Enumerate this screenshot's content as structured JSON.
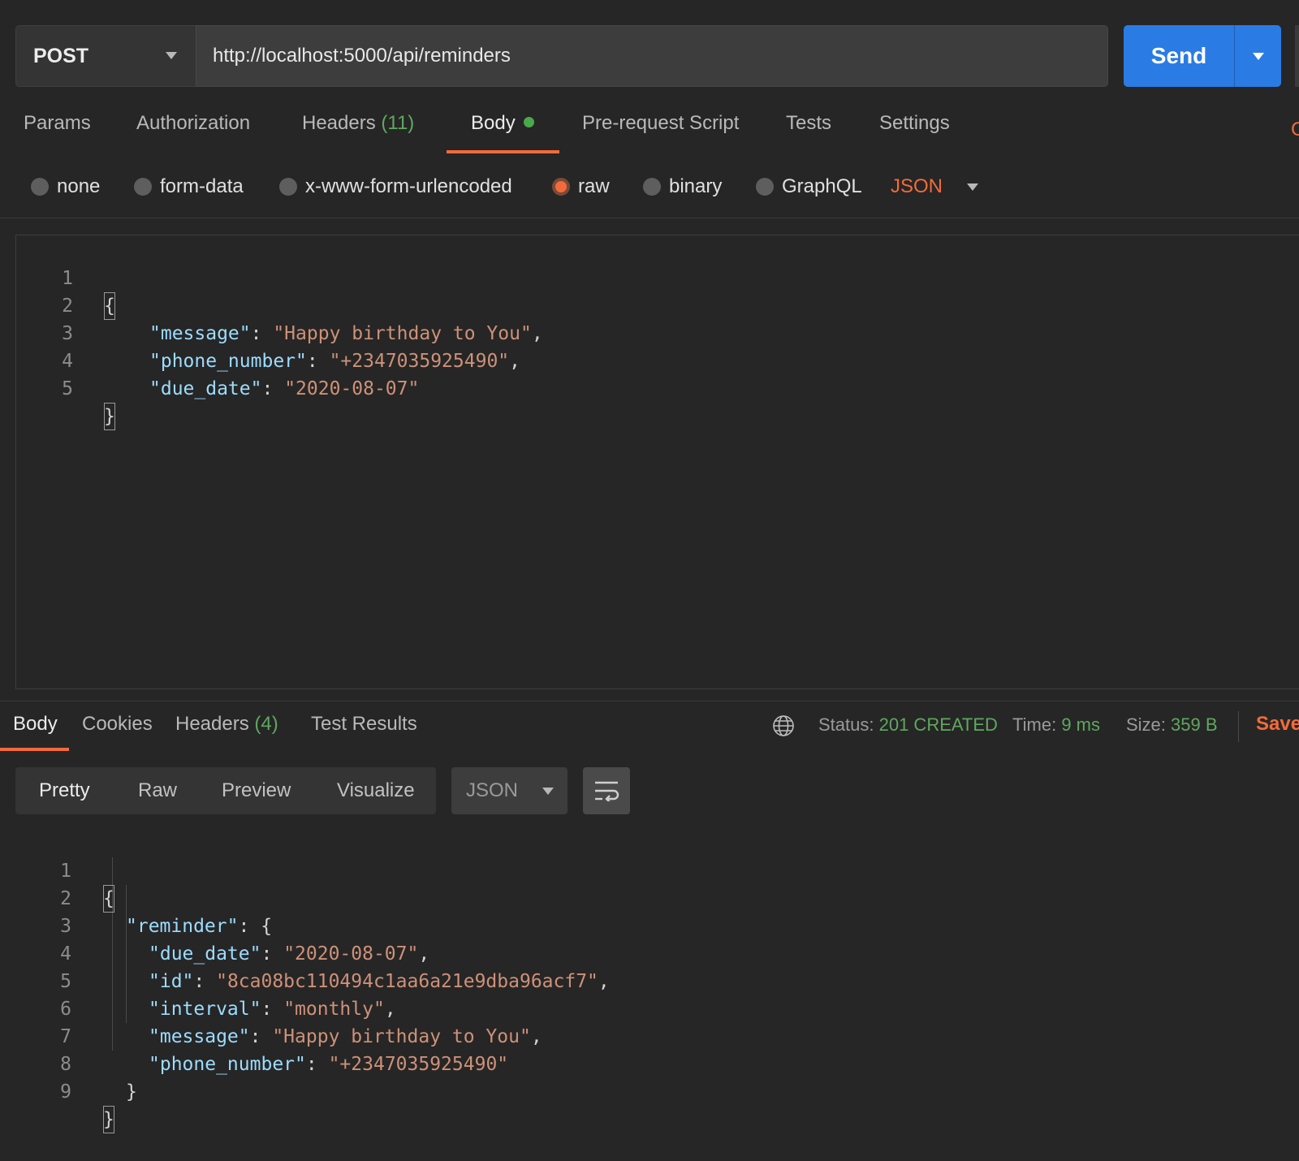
{
  "request": {
    "method": "POST",
    "url": "http://localhost:5000/api/reminders",
    "send_label": "Send"
  },
  "request_tabs": [
    {
      "label": "Params"
    },
    {
      "label": "Authorization"
    },
    {
      "label": "Headers",
      "count": "(11)"
    },
    {
      "label": "Body",
      "active": true
    },
    {
      "label": "Pre-request Script"
    },
    {
      "label": "Tests"
    },
    {
      "label": "Settings"
    }
  ],
  "cookies_edge": "C",
  "body_types": [
    {
      "label": "none"
    },
    {
      "label": "form-data"
    },
    {
      "label": "x-www-form-urlencoded"
    },
    {
      "label": "raw",
      "selected": true
    },
    {
      "label": "binary"
    },
    {
      "label": "GraphQL"
    }
  ],
  "body_language": "JSON",
  "request_body_lines": [
    {
      "n": "1",
      "text": "{"
    },
    {
      "n": "2",
      "key": "\"message\"",
      "value": "\"Happy birthday to You\"",
      "trail": ","
    },
    {
      "n": "3",
      "key": "\"phone_number\"",
      "value": "\"+2347035925490\"",
      "trail": ","
    },
    {
      "n": "4",
      "key": "\"due_date\"",
      "value": "\"2020-08-07\"",
      "trail": ""
    },
    {
      "n": "5",
      "text": "}"
    }
  ],
  "response_tabs": [
    {
      "label": "Body",
      "active": true
    },
    {
      "label": "Cookies"
    },
    {
      "label": "Headers",
      "count": "(4)"
    },
    {
      "label": "Test Results"
    }
  ],
  "response_status": {
    "status_label": "Status:",
    "status_value": "201 CREATED",
    "time_label": "Time:",
    "time_value": "9 ms",
    "size_label": "Size:",
    "size_value": "359 B",
    "save_label": "Save"
  },
  "response_views": [
    {
      "label": "Pretty",
      "active": true
    },
    {
      "label": "Raw"
    },
    {
      "label": "Preview"
    },
    {
      "label": "Visualize"
    }
  ],
  "response_language": "JSON",
  "response_body_lines": [
    {
      "n": "1",
      "text": "{"
    },
    {
      "n": "2",
      "key": "\"reminder\"",
      "value": "{",
      "trail": ""
    },
    {
      "n": "3",
      "key": "\"due_date\"",
      "value": "\"2020-08-07\"",
      "trail": ","
    },
    {
      "n": "4",
      "key": "\"id\"",
      "value": "\"8ca08bc110494c1aa6a21e9dba96acf7\"",
      "trail": ","
    },
    {
      "n": "5",
      "key": "\"interval\"",
      "value": "\"monthly\"",
      "trail": ","
    },
    {
      "n": "6",
      "key": "\"message\"",
      "value": "\"Happy birthday to You\"",
      "trail": ","
    },
    {
      "n": "7",
      "key": "\"phone_number\"",
      "value": "\"+2347035925490\"",
      "trail": ""
    },
    {
      "n": "8",
      "text": "}"
    },
    {
      "n": "9",
      "text": "}"
    }
  ],
  "colors": {
    "accent": "#f26b3a",
    "send_button": "#2b7be4",
    "success": "#5fa85f",
    "json_key": "#9cdcfe",
    "json_string": "#ce9178"
  }
}
